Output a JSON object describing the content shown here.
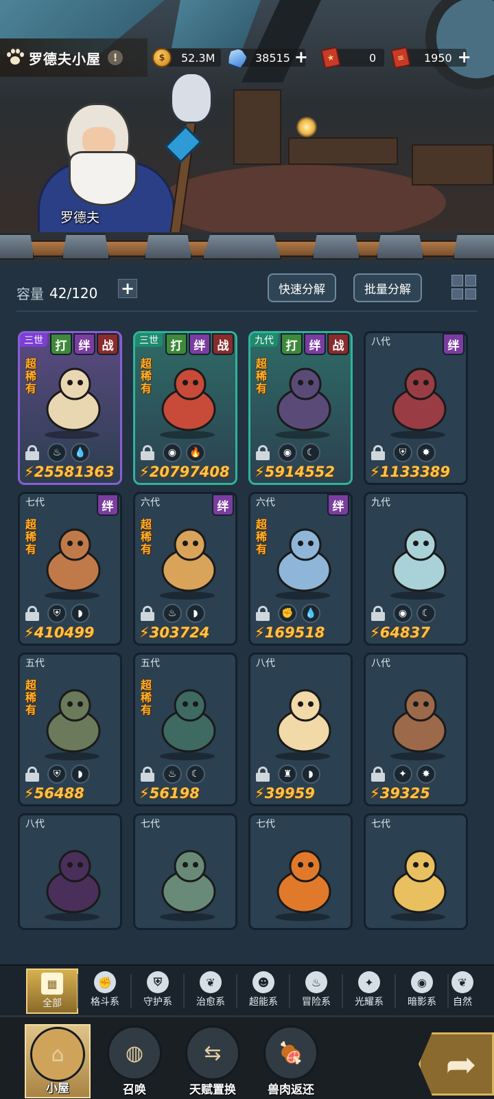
{
  "header": {
    "title": "罗德夫小屋",
    "info_icon": "!",
    "npc_name": "罗德夫"
  },
  "resources": [
    {
      "name": "coin-icon",
      "value": "52.3M"
    },
    {
      "name": "gem-icon",
      "value": "38515"
    },
    {
      "name": "ticket-red-icon",
      "value": "0"
    },
    {
      "name": "ticket-scroll-icon",
      "value": "1950"
    }
  ],
  "storage": {
    "capacity_label": "容量",
    "capacity_value": "42/120",
    "quick_decompose": "快速分解",
    "batch_decompose": "批量分解"
  },
  "cards": [
    {
      "gen": "三世",
      "tags": [
        "打",
        "绊",
        "战"
      ],
      "rare": "超稀有",
      "power": "25581363",
      "style": "purple",
      "elements": [
        "flame-icon",
        "water-icon"
      ]
    },
    {
      "gen": "三世",
      "tags": [
        "打",
        "绊",
        "战"
      ],
      "rare": "超稀有",
      "power": "20797408",
      "style": "teal",
      "elements": [
        "eye-icon",
        "fire-icon"
      ]
    },
    {
      "gen": "九代",
      "tags": [
        "打",
        "绊",
        "战"
      ],
      "rare": "超稀有",
      "power": "5914552",
      "style": "teal",
      "elements": [
        "eye-icon",
        "moon-icon"
      ]
    },
    {
      "gen": "八代",
      "tags": [
        "绊"
      ],
      "rare": "",
      "power": "1133389",
      "style": "",
      "elements": [
        "shield-icon",
        "star-icon"
      ]
    },
    {
      "gen": "七代",
      "tags": [
        "绊"
      ],
      "rare": "超稀有",
      "power": "410499",
      "style": "",
      "elements": [
        "shield-icon",
        "boot-icon"
      ]
    },
    {
      "gen": "六代",
      "tags": [
        "绊"
      ],
      "rare": "超稀有",
      "power": "303724",
      "style": "",
      "elements": [
        "flame-icon",
        "boot-icon"
      ]
    },
    {
      "gen": "六代",
      "tags": [
        "绊"
      ],
      "rare": "超稀有",
      "power": "169518",
      "style": "",
      "elements": [
        "fist-icon",
        "water-icon"
      ]
    },
    {
      "gen": "九代",
      "tags": [],
      "rare": "",
      "power": "64837",
      "style": "",
      "elements": [
        "eye-icon",
        "moon-icon"
      ]
    },
    {
      "gen": "五代",
      "tags": [],
      "rare": "超稀有",
      "power": "56488",
      "style": "",
      "elements": [
        "shield-icon",
        "boot-icon"
      ]
    },
    {
      "gen": "五代",
      "tags": [],
      "rare": "超稀有",
      "power": "56198",
      "style": "",
      "elements": [
        "flame-icon",
        "moon-icon"
      ]
    },
    {
      "gen": "八代",
      "tags": [],
      "rare": "",
      "power": "39959",
      "style": "",
      "elements": [
        "tower-icon",
        "boot-icon"
      ]
    },
    {
      "gen": "八代",
      "tags": [],
      "rare": "",
      "power": "39325",
      "style": "",
      "elements": [
        "compass-icon",
        "star-icon"
      ]
    },
    {
      "gen": "八代",
      "tags": [],
      "rare": "",
      "power": "",
      "style": "",
      "elements": []
    },
    {
      "gen": "七代",
      "tags": [],
      "rare": "",
      "power": "",
      "style": "",
      "elements": []
    },
    {
      "gen": "七代",
      "tags": [],
      "rare": "",
      "power": "",
      "style": "",
      "elements": []
    },
    {
      "gen": "七代",
      "tags": [],
      "rare": "",
      "power": "",
      "style": "",
      "elements": []
    }
  ],
  "categories": [
    {
      "label": "全部",
      "icon": "grid-icon"
    },
    {
      "label": "格斗系",
      "icon": "fist-icon"
    },
    {
      "label": "守护系",
      "icon": "shield-icon"
    },
    {
      "label": "治愈系",
      "icon": "leaf-icon"
    },
    {
      "label": "超能系",
      "icon": "alien-icon"
    },
    {
      "label": "冒险系",
      "icon": "flame-icon"
    },
    {
      "label": "光耀系",
      "icon": "compass-icon"
    },
    {
      "label": "暗影系",
      "icon": "eye-icon"
    },
    {
      "label": "自然",
      "icon": "leaf-icon"
    }
  ],
  "nav": [
    {
      "label": "小屋",
      "icon": "house-icon"
    },
    {
      "label": "召唤",
      "icon": "egg-icon"
    },
    {
      "label": "天赋置换",
      "icon": "swap-icon"
    },
    {
      "label": "兽肉返还",
      "icon": "meat-icon"
    }
  ],
  "colors": {
    "accent_gold": "#d8b050",
    "power_text": "#ffc24a",
    "rarity_text": "#ffb42a",
    "panel_bg": "#223240"
  }
}
